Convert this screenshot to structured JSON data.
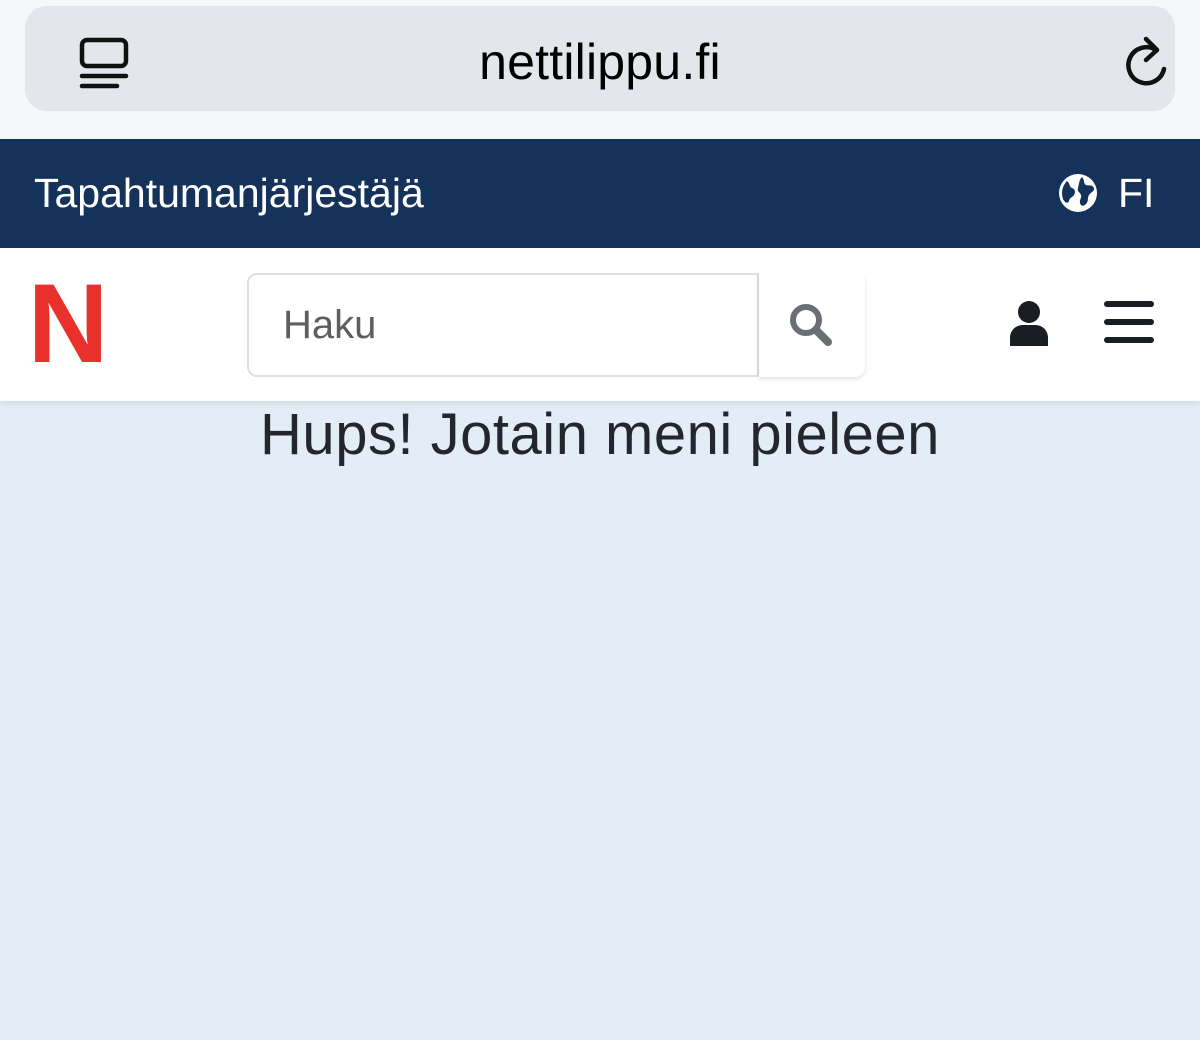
{
  "browser": {
    "url": "nettilippu.fi",
    "tabs_icon": "tabs-icon",
    "reload_icon": "reload-icon"
  },
  "topbar": {
    "organizer_link": "Tapahtumanjärjestäjä",
    "globe_icon": "globe-icon",
    "language": "FI"
  },
  "header": {
    "logo_letter": "N",
    "search": {
      "placeholder": "Haku",
      "value": ""
    },
    "search_icon": "search-icon",
    "user_icon": "user-icon",
    "menu_icon": "hamburger-menu-icon"
  },
  "main": {
    "error_title": "Hups! Jotain meni pieleen"
  },
  "colors": {
    "topbar_bg": "#15325a",
    "page_bg": "#e3edf7",
    "logo_red": "#e8312b",
    "title_text": "#23272d"
  }
}
